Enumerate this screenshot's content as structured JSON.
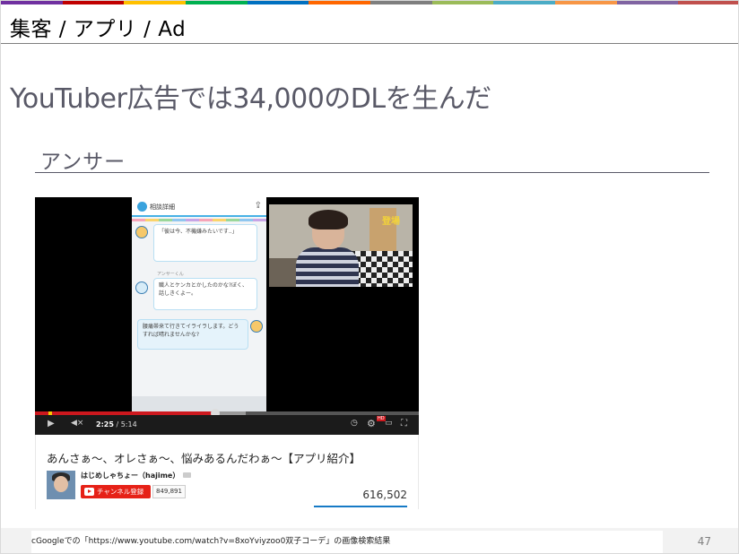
{
  "header": {
    "title": "集客 / アプリ / Ad"
  },
  "slide": {
    "title": "YouTuber広告では34,000のDLを生んだ",
    "subtitle": "アンサー",
    "page_number": "47"
  },
  "video": {
    "time_current": "2:25",
    "time_separator": " / ",
    "time_total": "5:14",
    "progress_fraction": 0.47,
    "buffer_fraction": 0.55,
    "title": "あんさぁ〜、オレさぁ〜、悩みあるんだわぁ〜【アプリ紹介】",
    "channel_name": "はじめしゃちょー（hajime）",
    "subscribe_label": "チャンネル登録",
    "subscriber_count": "849,891",
    "view_count": "616,502",
    "hd_badge": "HD"
  },
  "phone": {
    "header_label": "相談詳細",
    "bubble1": "「彼は今、不機嫌みたいです..」",
    "bubble2": "職人とケンカとかしたのかな?ぼく、話しきくよー。",
    "bubble2_name": "アンサーくん",
    "bubble3": "腰痛帯来て行きてイライラします。どうすれば晴れませんかな?",
    "webcam_caption": "登場"
  },
  "source_credit": "cGoogleでの「https://www.youtube.com/watch?v=8xoYviyzoo0双子コーデ」の画像検索結果",
  "colors": {
    "stripe": [
      "#7030a0",
      "#c00000",
      "#ffc000",
      "#00b050",
      "#0070c0",
      "#ff6600",
      "#7f7f7f",
      "#9bbb59",
      "#4bacc6",
      "#f79646",
      "#8064a2",
      "#c0504d"
    ],
    "youtube_red": "#cc181e",
    "text_gray": "#595967"
  }
}
